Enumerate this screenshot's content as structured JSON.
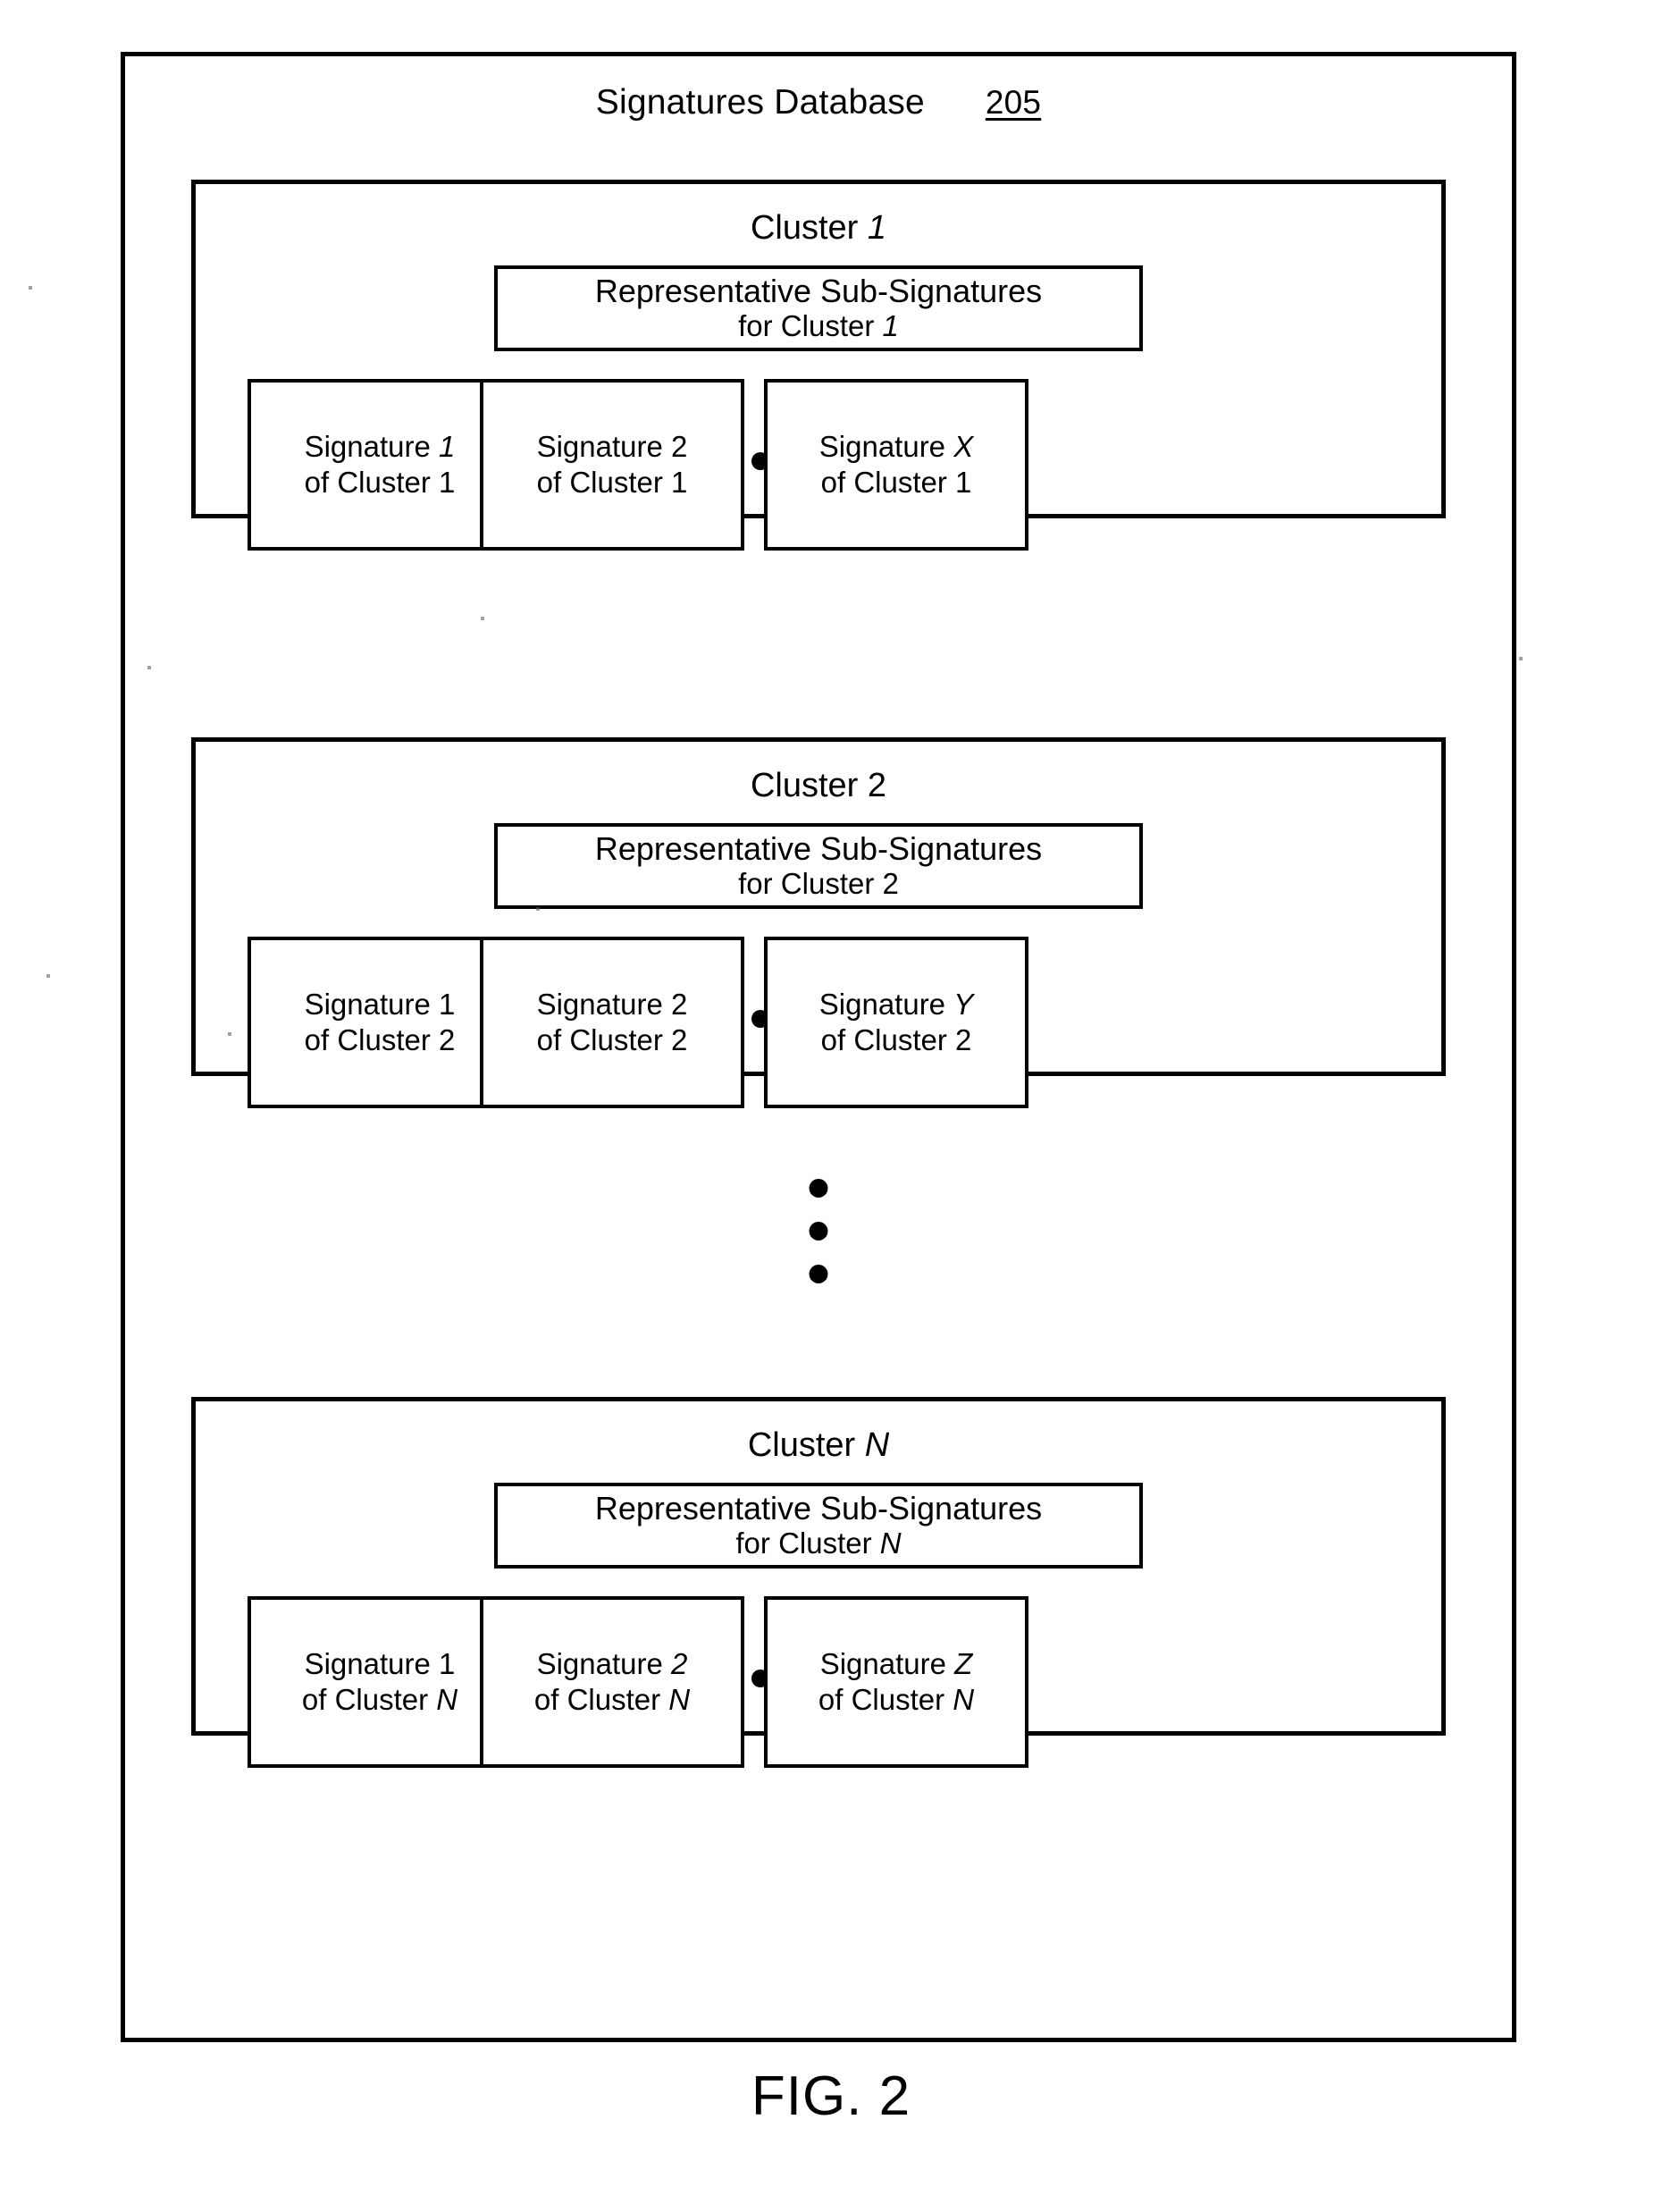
{
  "figure": {
    "caption": "FIG. 2",
    "database_title": "Signatures Database",
    "reference_numeral": "205"
  },
  "clusters": [
    {
      "title_prefix": "Cluster ",
      "title_id": "1",
      "title_id_italic": false,
      "repsub": {
        "line1": "Representative Sub-Signatures",
        "line2_prefix": "for Cluster ",
        "line2_id": "1",
        "line2_id_italic": false
      },
      "signatures": [
        {
          "line1_prefix": "Signature ",
          "line1_id": "1",
          "line1_id_italic": false,
          "line2_prefix": "of Cluster ",
          "line2_id": "1",
          "line2_id_italic": false
        },
        {
          "line1_prefix": "Signature ",
          "line1_id": "2",
          "line1_id_italic": false,
          "line2_prefix": "of Cluster ",
          "line2_id": "1",
          "line2_id_italic": false
        },
        {
          "line1_prefix": "Signature ",
          "line1_id": "X",
          "line1_id_italic": true,
          "line2_prefix": "of Cluster ",
          "line2_id": "1",
          "line2_id_italic": false
        }
      ]
    },
    {
      "title_prefix": "Cluster ",
      "title_id": "2",
      "title_id_italic": false,
      "repsub": {
        "line1": "Representative Sub-Signatures",
        "line2_prefix": "for Cluster ",
        "line2_id": "2",
        "line2_id_italic": false
      },
      "signatures": [
        {
          "line1_prefix": "Signature ",
          "line1_id": "1",
          "line1_id_italic": false,
          "line2_prefix": "of Cluster ",
          "line2_id": "2",
          "line2_id_italic": false
        },
        {
          "line1_prefix": "Signature ",
          "line1_id": "2",
          "line1_id_italic": false,
          "line2_prefix": "of Cluster ",
          "line2_id": "2",
          "line2_id_italic": false
        },
        {
          "line1_prefix": "Signature ",
          "line1_id": "Y",
          "line1_id_italic": true,
          "line2_prefix": "of Cluster ",
          "line2_id": "2",
          "line2_id_italic": false
        }
      ]
    },
    {
      "title_prefix": "Cluster ",
      "title_id": "N",
      "title_id_italic": true,
      "repsub": {
        "line1": "Representative Sub-Signatures",
        "line2_prefix": "for Cluster ",
        "line2_id": "N",
        "line2_id_italic": true
      },
      "signatures": [
        {
          "line1_prefix": "Signature ",
          "line1_id": "1",
          "line1_id_italic": false,
          "line2_prefix": "of Cluster ",
          "line2_id": "N",
          "line2_id_italic": true
        },
        {
          "line1_prefix": "Signature ",
          "line1_id": "2",
          "line1_id_italic": true,
          "line2_prefix": "of Cluster ",
          "line2_id": "N",
          "line2_id_italic": true
        },
        {
          "line1_prefix": "Signature ",
          "line1_id": "Z",
          "line1_id_italic": true,
          "line2_prefix": "of Cluster ",
          "line2_id": "N",
          "line2_id_italic": true
        }
      ]
    }
  ],
  "ellipsis": {
    "horizontal_dots": 3,
    "vertical_dots": 3
  },
  "colors": {
    "ink": "#000000",
    "paper": "#ffffff"
  }
}
